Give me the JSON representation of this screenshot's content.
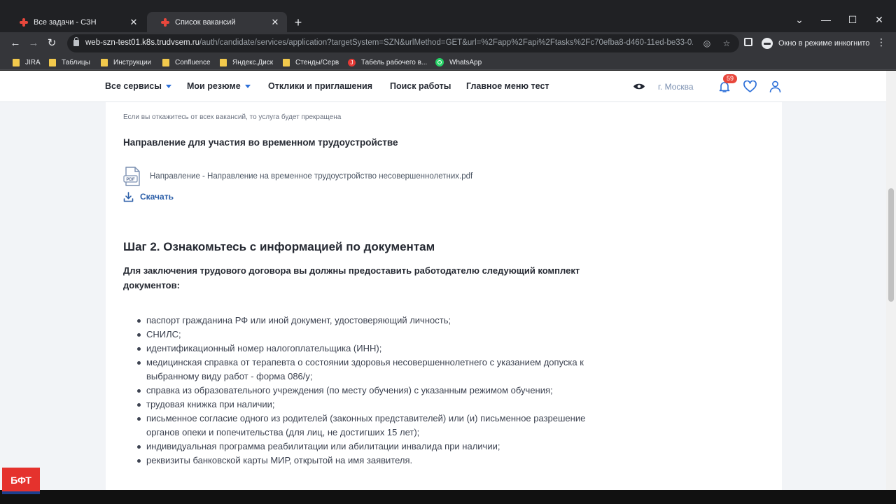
{
  "browser": {
    "tabs": [
      {
        "title": "Все задачи - СЗН",
        "active": false
      },
      {
        "title": "Список вакансий",
        "active": true
      }
    ],
    "new_tab": "+",
    "window_controls": {
      "minimize": "—",
      "maximize": "☐",
      "close": "✕",
      "collapse": "⌄"
    },
    "address": {
      "host": "web-szn-test01.k8s.trudvsem.ru",
      "path": "/auth/candidate/services/application?targetSystem=SZN&urlMethod=GET&url=%2Fapp%2Fapi%2Ftasks%2Fc70efba8-d460-11ed-be33-0..."
    },
    "incognito_label": "Окно в режиме инкогнито",
    "bookmarks": [
      {
        "label": "JIRA",
        "icon": "folder-icon"
      },
      {
        "label": "Таблицы",
        "icon": "folder-icon"
      },
      {
        "label": "Инструкции",
        "icon": "folder-icon"
      },
      {
        "label": "Confluence",
        "icon": "folder-icon"
      },
      {
        "label": "Яндекс.Диск",
        "icon": "folder-icon"
      },
      {
        "label": "Стенды/Серв",
        "icon": "folder-icon"
      },
      {
        "label": "Табель рабочего в...",
        "icon": "j-icon",
        "glyph": "J"
      },
      {
        "label": "WhatsApp",
        "icon": "whatsapp-icon"
      }
    ]
  },
  "site": {
    "nav": [
      {
        "label": "Все сервисы",
        "dropdown": true
      },
      {
        "label": "Мои резюме",
        "dropdown": true
      },
      {
        "label": "Отклики и приглашения",
        "dropdown": false
      },
      {
        "label": "Поиск работы",
        "dropdown": false
      },
      {
        "label": "Главное меню тест",
        "dropdown": false
      }
    ],
    "city": "г. Москва",
    "notifications_count": "59",
    "accent_color": "#2c6fd8"
  },
  "content": {
    "note": "Если вы откажитесь от всех вакансий, то услуга будет прекращена",
    "section_title": "Направление для участия во временном трудоустройстве",
    "file": {
      "label": "Направление - Направление на временное трудоустройство несовершеннолетних.pdf",
      "icon_text": "PDF"
    },
    "download_label": "Скачать",
    "step_title": "Шаг 2. Ознакомьтесь с информацией по документам",
    "lead": "Для заключения трудового договора вы должны предоставить работодателю следующий комплект документов:",
    "documents": [
      "паспорт гражданина РФ или иной документ, удостоверяющий личность;",
      "СНИЛС;",
      "идентификационный номер налогоплательщика (ИНН);",
      "медицинская справка от терапевта о состоянии здоровья несовершеннолетнего с указанием допуска к выбранному виду работ - форма 086/у;",
      "справка из образовательного учреждения (по месту обучения) с указанным режимом обучения;",
      "трудовая книжка при наличии;",
      "письменное согласие одного из родителей (законных представителей) или (и) письменное разрешение органов опеки и попечительства (для лиц, не достигших 15 лет);",
      "индивидуальная программа реабилитации или абилитации инвалида при наличии;",
      "реквизиты банковской карты МИР, открытой на имя заявителя."
    ]
  },
  "overlay": {
    "logo_text": "БФТ"
  }
}
